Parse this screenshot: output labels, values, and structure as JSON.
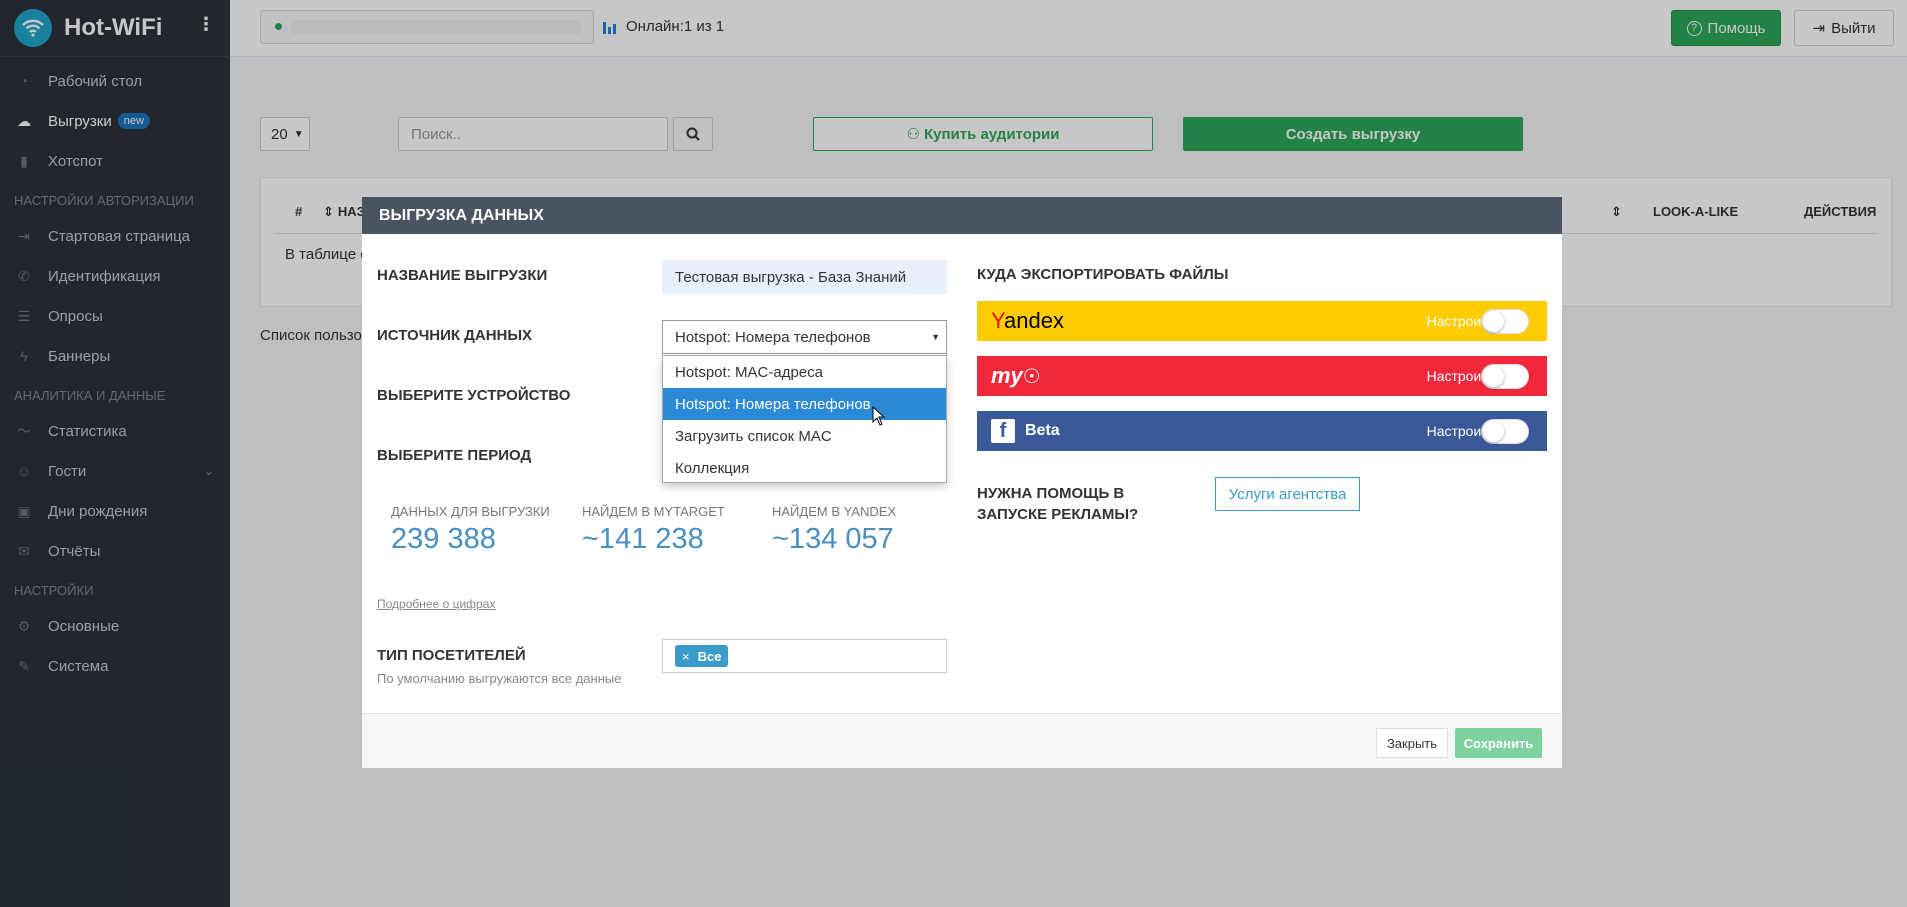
{
  "brand": {
    "name": "Hot-WiFi",
    "menu_icon": "vertical-dots-icon"
  },
  "sidebar": {
    "items": [
      {
        "label": "Рабочий стол",
        "icon": "dashboard-icon"
      },
      {
        "label": "Выгрузки",
        "badge": "new",
        "icon": "cloud-upload-icon"
      },
      {
        "label": "Хотспот",
        "icon": "bar-chart-icon"
      }
    ],
    "section_auth": "НАСТРОЙКИ АВТОРИЗАЦИИ",
    "auth_items": [
      {
        "label": "Стартовая страница",
        "icon": "sign-in-icon"
      },
      {
        "label": "Идентификация",
        "icon": "phone-icon"
      },
      {
        "label": "Опросы",
        "icon": "list-icon"
      },
      {
        "label": "Баннеры",
        "icon": "bolt-icon"
      }
    ],
    "section_analytics": "АНАЛИТИКА И ДАННЫЕ",
    "analytics_items": [
      {
        "label": "Статистика",
        "icon": "line-chart-icon"
      },
      {
        "label": "Гости",
        "icon": "users-icon"
      },
      {
        "label": "Дни рождения",
        "icon": "gift-icon"
      },
      {
        "label": "Отчёты",
        "icon": "mail-icon"
      }
    ],
    "section_settings": "НАСТРОЙКИ",
    "settings_items": [
      {
        "label": "Основные",
        "icon": "gear-icon"
      },
      {
        "label": "Система",
        "icon": "wrench-icon"
      }
    ]
  },
  "topbar": {
    "online": "Онлайн:1 из 1",
    "help": "Помощь",
    "logout": "Выйти"
  },
  "toolbar": {
    "page_size": "20",
    "search_placeholder": "Поиск..",
    "buy": "Купить аудитории",
    "create": "Создать выгрузку"
  },
  "table": {
    "headers": [
      "#",
      "НАЗ",
      "LOOK-A-LIKE",
      "ДЕЙСТВИЯ"
    ],
    "empty": "В таблице с",
    "footer": "Список пользо"
  },
  "modal": {
    "title": "ВЫГРУЗКА ДАННЫХ",
    "name_label": "НАЗВАНИЕ ВЫГРУЗКИ",
    "name_value": "Тестовая выгрузка - База Знаний",
    "source_label": "ИСТОЧНИК ДАННЫХ",
    "source_value": "Hotspot: Номера телефонов",
    "source_options": [
      "Hotspot: MAC-адреса",
      "Hotspot: Номера телефонов",
      "Загрузить список MAC",
      "Коллекция"
    ],
    "source_selected_index": 1,
    "device_label": "ВЫБЕРИТЕ УСТРОЙСТВО",
    "period_label": "ВЫБЕРИТЕ ПЕРИОД",
    "stats": [
      {
        "label": "ДАННЫХ ДЛЯ ВЫГРУЗКИ",
        "value": "239 388"
      },
      {
        "label": "НАЙДЕМ В MYTARGET",
        "value": "~141 238"
      },
      {
        "label": "НАЙДЕМ В YANDEX",
        "value": "~134 057"
      }
    ],
    "more_link": "Подробнее о цифрах",
    "visitors_label": "ТИП ПОСЕТИТЕЛЕЙ",
    "visitors_hint": "По умолчанию выгружаются все данные",
    "visitors_tag": "Все",
    "export_title": "КУДА ЭКСПОРТИРОВАТЬ ФАЙЛЫ",
    "exports": [
      {
        "name": "Yandex",
        "configure": "Настроить",
        "color": "#ffcc00"
      },
      {
        "name": "my.com",
        "configure": "Настроить",
        "color": "#f0283c"
      },
      {
        "name": "Beta",
        "configure": "Настроить",
        "color": "#3b5998"
      }
    ],
    "help_question": "НУЖНА ПОМОЩЬ В ЗАПУСКЕ РЕКЛАМЫ?",
    "agency_button": "Услуги агентства",
    "close": "Закрыть",
    "save": "Сохранить"
  },
  "colors": {
    "accent_green": "#2ea85b",
    "sidebar_bg": "#2c333c",
    "modal_header": "#4a5361",
    "select_blue": "#2a8ad8"
  }
}
